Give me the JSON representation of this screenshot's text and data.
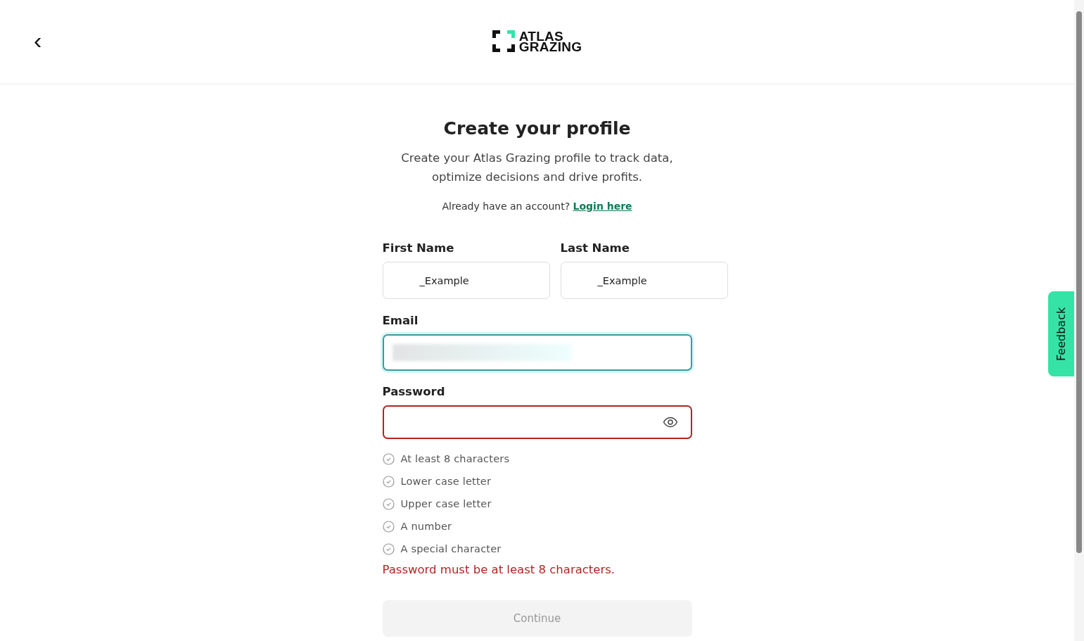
{
  "header": {
    "back": "‹",
    "logo": {
      "line1": "ATLAS",
      "line2": "GRAZING"
    }
  },
  "title": "Create your profile",
  "subtitle": "Create your Atlas Grazing profile to track data, optimize decisions and drive profits.",
  "login": {
    "prompt": "Already have an account?",
    "link": "Login here"
  },
  "fields": [
    {
      "label": "First Name",
      "value": "_Example",
      "focused": false,
      "error": false
    },
    {
      "label": "Last Name",
      "value": "_Example",
      "focused": false,
      "error": false
    },
    {
      "label": "Email",
      "focused": true,
      "error": false
    },
    {
      "label": "Password",
      "focused": false,
      "error": true
    }
  ],
  "requirements": [
    {
      "text": "At least 8 characters",
      "checked": false
    },
    {
      "text": "Lower case letter",
      "checked": false
    },
    {
      "text": "Upper case letter",
      "checked": false
    },
    {
      "text": "A number",
      "checked": false
    },
    {
      "text": "A special character",
      "checked": false
    }
  ],
  "error_message": "Password must be at least 8 characters.",
  "continue": {
    "label": "Continue",
    "disabled": true
  },
  "feedback": "Feedback"
}
